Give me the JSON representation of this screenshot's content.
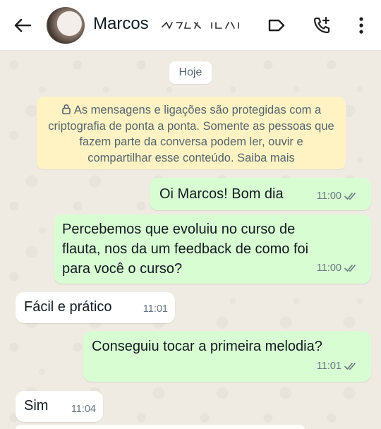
{
  "header": {
    "contact_name": "Marcos",
    "icons": [
      "back-arrow-icon",
      "label-icon",
      "add-call-icon",
      "more-vert-icon"
    ]
  },
  "chat": {
    "date_chip": "Hoje",
    "encryption_notice": "As mensagens e ligações são protegidas com a criptografia de ponta a ponta. Somente as pessoas que fazem parte da conversa podem ler, ouvir e compartilhar esse conteúdo. Saiba mais",
    "messages": [
      {
        "direction": "outgoing",
        "text": "Oi Marcos! Bom dia",
        "time": "11:00",
        "status": "read"
      },
      {
        "direction": "outgoing",
        "text": "Percebemos que evoluiu no curso de flauta, nos da um feedback de como foi para você o curso?",
        "time": "11:00",
        "status": "read"
      },
      {
        "direction": "incoming",
        "text": "Fácil e prático",
        "time": "11:01"
      },
      {
        "direction": "outgoing",
        "text": "Conseguiu tocar a primeira melodia?",
        "time": "11:01",
        "status": "read"
      },
      {
        "direction": "incoming",
        "text": "Sim",
        "time": "11:04"
      }
    ]
  },
  "colors": {
    "outgoing_bubble": "#d9fdd3",
    "incoming_bubble": "#ffffff",
    "notice_bg": "#fff3c4",
    "chat_bg": "#efeae2"
  }
}
